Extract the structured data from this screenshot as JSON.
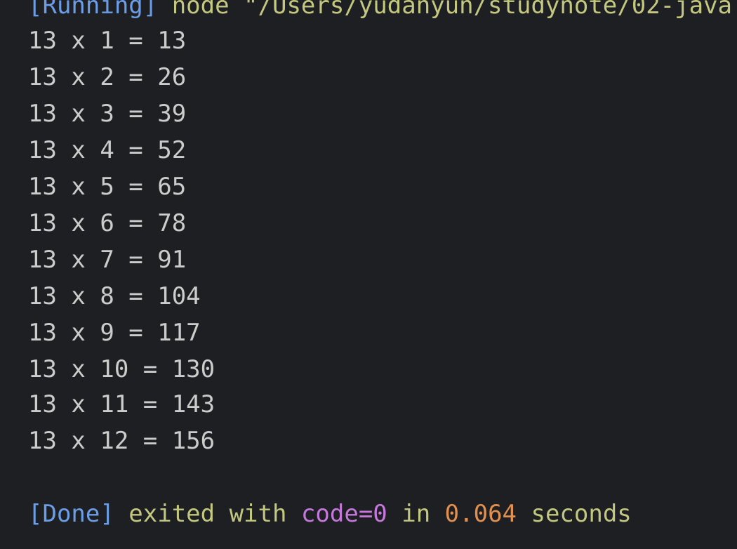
{
  "header": {
    "running_tag": "[Running]",
    "running_cmd": " node \"/Users/yudanyun/studynote/02-java"
  },
  "output_lines": [
    "13 x 1 = 13",
    "13 x 2 = 26",
    "13 x 3 = 39",
    "13 x 4 = 52",
    "13 x 5 = 65",
    "13 x 6 = 78",
    "13 x 7 = 91",
    "13 x 8 = 104",
    "13 x 9 = 117",
    "13 x 10 = 130",
    "13 x 11 = 143",
    "13 x 12 = 156"
  ],
  "footer": {
    "done_tag": "[Done]",
    "exited_text": " exited with ",
    "code_text": "code=0",
    "in_text": " in ",
    "time_text": "0.064",
    "seconds_text": " seconds"
  },
  "colors": {
    "background": "#1e1f22",
    "tag": "#6c9ee8",
    "command": "#c3c77f",
    "output": "#cccccc",
    "code": "#c678dd",
    "time": "#e2904f"
  }
}
